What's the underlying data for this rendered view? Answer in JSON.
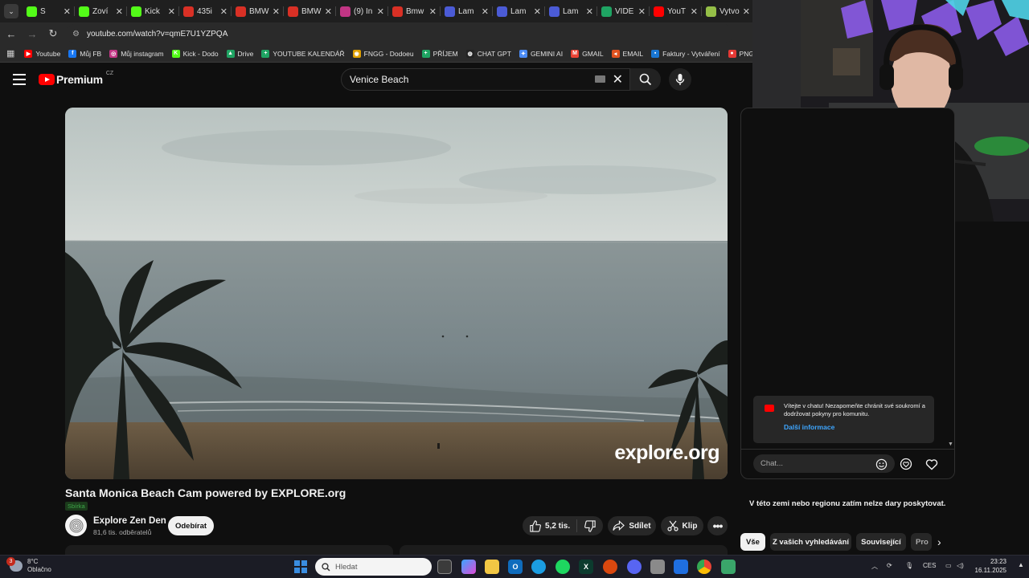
{
  "browser": {
    "tabs": [
      {
        "label": "S",
        "icon": "kick-icon",
        "color": "#53fc18"
      },
      {
        "label": "Zoví",
        "icon": "kick-icon",
        "color": "#53fc18"
      },
      {
        "label": "Kick",
        "icon": "kick-icon",
        "color": "#53fc18"
      },
      {
        "label": "435i",
        "icon": "bmw-forum-icon",
        "color": "#d93025"
      },
      {
        "label": "BMW",
        "icon": "bmw-forum-icon",
        "color": "#d93025"
      },
      {
        "label": "BMW",
        "icon": "bmw-forum-icon",
        "color": "#d93025"
      },
      {
        "label": "(9) In",
        "icon": "instagram-icon",
        "color": "#c13584"
      },
      {
        "label": "Bmw",
        "icon": "bmw-icon",
        "color": "#d93025"
      },
      {
        "label": "Lam",
        "icon": "c-icon",
        "color": "#4b5bd6"
      },
      {
        "label": "Lam",
        "icon": "c-icon",
        "color": "#4b5bd6"
      },
      {
        "label": "Lam",
        "icon": "c-icon",
        "color": "#4b5bd6"
      },
      {
        "label": "VIDE",
        "icon": "sheets-icon",
        "color": "#1fa463"
      },
      {
        "label": "YouT",
        "icon": "youtube-icon",
        "color": "#ff0000"
      },
      {
        "label": "Vytvo",
        "icon": "shopify-icon",
        "color": "#95bf47"
      }
    ],
    "address": "youtube.com/watch?v=qmE7U1YZPQA",
    "bookmarks": [
      {
        "label": "Youtube",
        "color": "#ff0000",
        "glyph": "▶"
      },
      {
        "label": "Můj FB",
        "color": "#1877f2",
        "glyph": "f"
      },
      {
        "label": "Můj instagram",
        "color": "#c13584",
        "glyph": "◎"
      },
      {
        "label": "Kick - Dodo",
        "color": "#53fc18",
        "glyph": "K"
      },
      {
        "label": "Drive",
        "color": "#1fa463",
        "glyph": "▲"
      },
      {
        "label": "YOUTUBE KALENDÁŘ",
        "color": "#1fa463",
        "glyph": "+"
      },
      {
        "label": "FNGG - Dodoeu",
        "color": "#e0a000",
        "glyph": "◉"
      },
      {
        "label": "PŘÍJEM",
        "color": "#1fa463",
        "glyph": "+"
      },
      {
        "label": "CHAT GPT",
        "color": "#222222",
        "glyph": "◍"
      },
      {
        "label": "GEMINI AI",
        "color": "#4b8bf5",
        "glyph": "✦"
      },
      {
        "label": "GMAIL",
        "color": "#ea4335",
        "glyph": "M"
      },
      {
        "label": "EMAIL",
        "color": "#e0521f",
        "glyph": "◂"
      },
      {
        "label": "Faktury - Vytváření",
        "color": "#1976d2",
        "glyph": "▪"
      },
      {
        "label": "PNG to PDF",
        "color": "#e53935",
        "glyph": "●"
      }
    ]
  },
  "youtube": {
    "logo_text": "Premium",
    "country": "CZ",
    "search_value": "Venice Beach",
    "video": {
      "watermark": "explore.org",
      "title": "Santa Monica Beach Cam powered by EXPLORE.org",
      "tag": "Sbírka",
      "channel": "Explore Zen Den",
      "subscribers": "81,6 tis. odběratelů",
      "subscribe_label": "Odebírat",
      "likes": "5,2 tis.",
      "share_label": "Sdílet",
      "clip_label": "Klip"
    },
    "chat": {
      "notice": "Vítejte v chatu! Nezapomeňte chránit své soukromí a dodržovat pokyny pro komunitu.",
      "notice_link": "Další informace",
      "input_placeholder": "Chat..."
    },
    "donation_note": "V této zemi nebo regionu zatím nelze dary poskytovat.",
    "chips": [
      "Vše",
      "Z vašich vyhledávání",
      "Související",
      "Pro"
    ]
  },
  "taskbar": {
    "weather_temp": "8°C",
    "weather_desc": "Oblačno",
    "weather_badge": "3",
    "search_placeholder": "Hledat",
    "language": "CES",
    "time": "23:23",
    "date": "16.11.2025"
  }
}
